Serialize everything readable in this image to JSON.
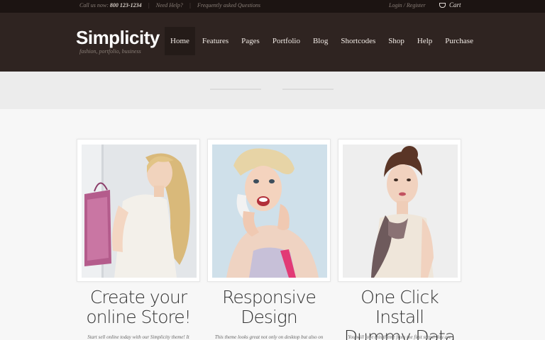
{
  "topbar": {
    "call_label": "Call us now:",
    "phone": "800 123-1234",
    "help_link": "Need Help?",
    "faq_link": "Frequently asked Questions",
    "login_link": "Login / Register",
    "cart_label": "Cart"
  },
  "header": {
    "logo": "Simplicity",
    "tagline": "fashion, portfolio, business"
  },
  "nav": {
    "items": [
      "Home",
      "Features",
      "Pages",
      "Portfolio",
      "Blog",
      "Shortcodes",
      "Shop",
      "Help",
      "Purchase"
    ],
    "active": "Home"
  },
  "features": [
    {
      "title_line1": "Create your",
      "title_line2": "online Store!",
      "text": "Start sell online today with our Simplicity theme! It"
    },
    {
      "title_line1": "Responsive",
      "title_line2": "Design",
      "text": "This theme looks great not only on desktop but also on"
    },
    {
      "title_line1": "One Click Install",
      "title_line2": "Dummy Data",
      "text": "You will love this theme from the first steps! You are"
    }
  ],
  "colors": {
    "topbar_bg": "#1c1412",
    "header_bg": "#2f2421",
    "nav_active_bg": "#241b18",
    "page_bg": "#f7f7f7"
  }
}
